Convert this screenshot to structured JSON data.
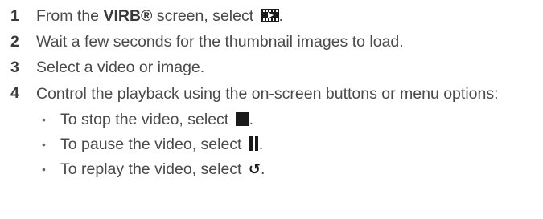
{
  "steps": [
    {
      "number": "1",
      "before": "From the ",
      "bold": "VIRB®",
      "after": " screen, select ",
      "icon": "video-playback-icon",
      "end": "."
    },
    {
      "number": "2",
      "text": "Wait a few seconds for the thumbnail images to load."
    },
    {
      "number": "3",
      "text": "Select a video or image."
    },
    {
      "number": "4",
      "text": "Control the playback using the on-screen buttons or menu options:",
      "sub_items": [
        {
          "bullet": "•",
          "text": "To stop the video, select ",
          "icon": "stop-icon",
          "end": "."
        },
        {
          "bullet": "•",
          "text": "To pause the video, select ",
          "icon": "pause-icon",
          "end": "."
        },
        {
          "bullet": "•",
          "text": "To replay the video, select ",
          "icon": "replay-icon",
          "glyph": "↺",
          "end": "."
        }
      ]
    }
  ],
  "colors": {
    "text": "#4a4a4a",
    "number": "#3a3a3a",
    "icon": "#1a1a1a"
  }
}
